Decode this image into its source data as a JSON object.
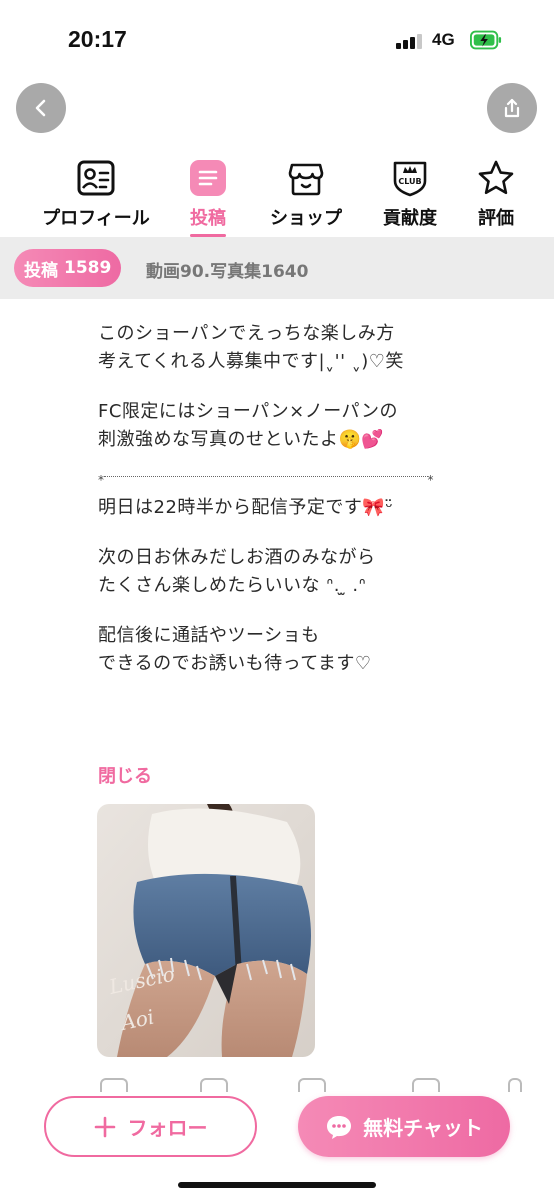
{
  "status": {
    "time": "20:17",
    "network": "4G"
  },
  "tabs": [
    {
      "label": "プロフィール",
      "icon": "profile-card-icon"
    },
    {
      "label": "投稿",
      "icon": "post-list-icon"
    },
    {
      "label": "ショップ",
      "icon": "shop-icon"
    },
    {
      "label": "貢献度",
      "icon": "club-badge-icon"
    },
    {
      "label": "評価",
      "icon": "star-icon"
    }
  ],
  "counts": {
    "label": "投稿",
    "value": "1589",
    "sub": "動画90.写真集1640"
  },
  "post": {
    "p1_line1": "このショーパンでえっちな楽しみ方",
    "p1_line2": "考えてくれる人募集中です|ˬ'' ˬ)♡笑",
    "p2_line1": "FC限定にはショーパン×ノーパンの",
    "p2_line2": "刺激強めな写真のせといたよ🤫💕",
    "separator_star": "*",
    "p3_line1": "明日は22時半から配信予定です🎀ᵕ̈",
    "p4_line1": "次の日お休みだしお酒のみながら",
    "p4_line2": "たくさん楽しめたらいいな ᐢ. ̫ .ᐢ",
    "p5_line1": "配信後に通話やツーショも",
    "p5_line2": "できるのでお誘いも待ってます♡",
    "close_label": "閉じる"
  },
  "photo": {
    "watermark_line1": "Luscio",
    "watermark_line2": "Aoi"
  },
  "footer": {
    "follow_label": "フォロー",
    "chat_label": "無料チャット"
  },
  "colors": {
    "accent": "#f06aa0",
    "accent_light": "#f58ab6",
    "count_bar_bg": "#ececec",
    "round_btn": "#a9a9a9"
  }
}
